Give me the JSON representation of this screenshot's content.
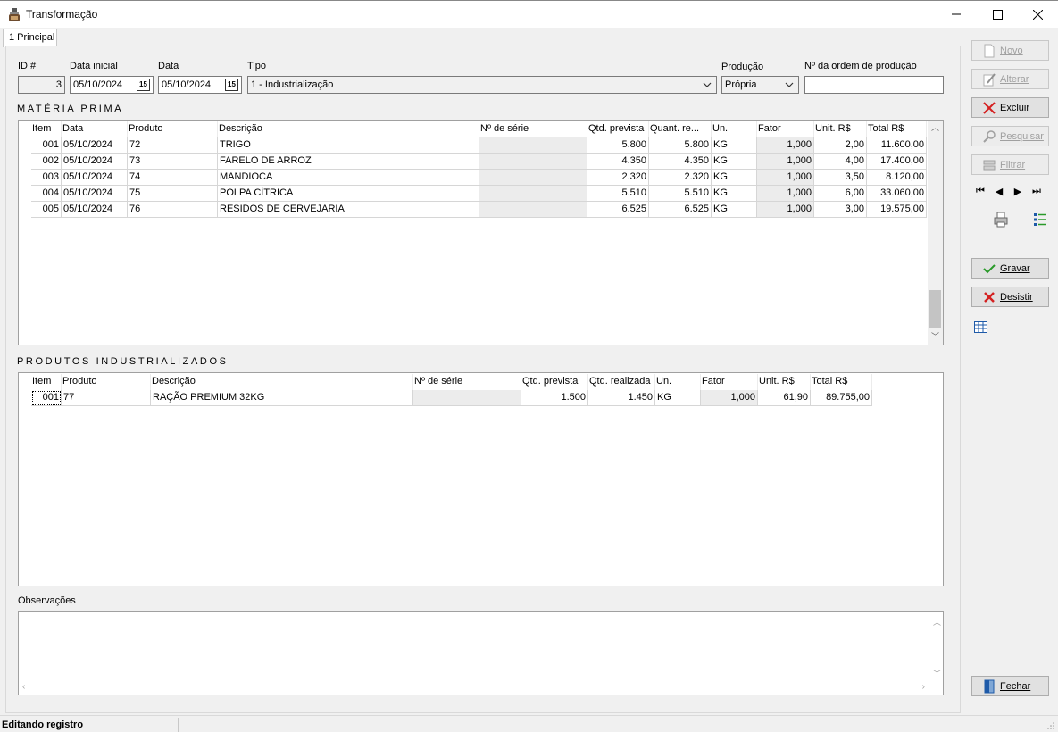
{
  "window": {
    "title": "Transformação"
  },
  "tabs": [
    {
      "label": "1 Principal"
    }
  ],
  "form": {
    "id_label": "ID #",
    "id_value": "3",
    "data_inicial_label": "Data inicial",
    "data_inicial_value": "05/10/2024",
    "data_label": "Data",
    "data_value": "05/10/2024",
    "tipo_label": "Tipo",
    "tipo_value": "1 - Industrialização",
    "producao_label": "Produção",
    "producao_value": "Própria",
    "ordem_label": "Nº da ordem de produção",
    "ordem_value": "",
    "calendar_glyph": "15"
  },
  "materia_prima": {
    "title": "MATÉRIA PRIMA",
    "columns": [
      "Item",
      "Data",
      "Produto",
      "Descrição",
      "Nº de série",
      "Qtd. prevista",
      "Quant. re...",
      "Un.",
      "Fator",
      "Unit. R$",
      "Total R$"
    ],
    "rows": [
      [
        "001",
        "05/10/2024",
        "72",
        "TRIGO",
        "",
        "5.800",
        "5.800",
        "KG",
        "1,000",
        "2,00",
        "11.600,00"
      ],
      [
        "002",
        "05/10/2024",
        "73",
        "FARELO DE ARROZ",
        "",
        "4.350",
        "4.350",
        "KG",
        "1,000",
        "4,00",
        "17.400,00"
      ],
      [
        "003",
        "05/10/2024",
        "74",
        "MANDIOCA",
        "",
        "2.320",
        "2.320",
        "KG",
        "1,000",
        "3,50",
        "8.120,00"
      ],
      [
        "004",
        "05/10/2024",
        "75",
        "POLPA CÍTRICA",
        "",
        "5.510",
        "5.510",
        "KG",
        "1,000",
        "6,00",
        "33.060,00"
      ],
      [
        "005",
        "05/10/2024",
        "76",
        "RESIDOS DE CERVEJARIA",
        "",
        "6.525",
        "6.525",
        "KG",
        "1,000",
        "3,00",
        "19.575,00"
      ]
    ]
  },
  "produtos": {
    "title": "PRODUTOS INDUSTRIALIZADOS",
    "columns": [
      "Item",
      "Produto",
      "Descrição",
      "Nº de série",
      "Qtd. prevista",
      "Qtd. realizada",
      "Un.",
      "Fator",
      "Unit. R$",
      "Total R$"
    ],
    "rows": [
      [
        "001",
        "77",
        "RAÇÃO PREMIUM 32KG",
        "",
        "1.500",
        "1.450",
        "KG",
        "1,000",
        "61,90",
        "89.755,00"
      ]
    ]
  },
  "observacoes": {
    "label": "Observações",
    "value": ""
  },
  "sidebar": {
    "novo": "Novo",
    "alterar": "Alterar",
    "excluir": "Excluir",
    "pesquisar": "Pesquisar",
    "filtrar": "Filtrar",
    "gravar": "Gravar",
    "desistir": "Desistir",
    "fechar": "Fechar"
  },
  "status": {
    "text": "Editando registro"
  },
  "colors": {
    "accent_blue": "#1e5aa8",
    "danger_red": "#d42020",
    "ok_green": "#2a9a2a"
  }
}
